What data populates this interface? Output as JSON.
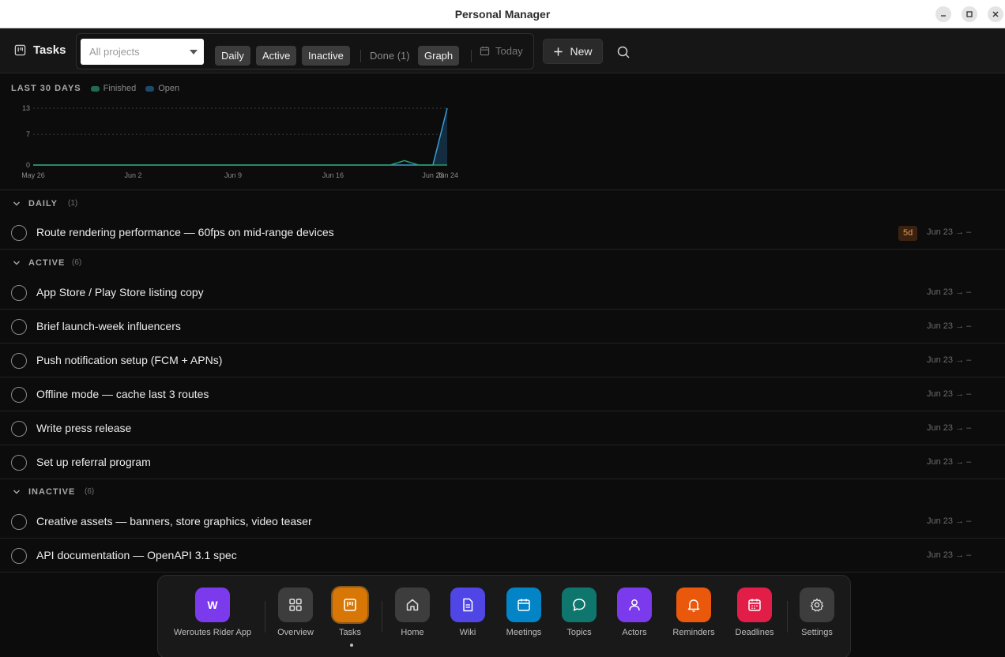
{
  "window": {
    "title": "Personal Manager"
  },
  "toolbar": {
    "title": "Tasks",
    "project_select": {
      "placeholder": "All projects"
    },
    "filters": [
      {
        "label": "Daily",
        "active": true
      },
      {
        "label": "Active",
        "active": true
      },
      {
        "label": "Inactive",
        "active": true
      },
      {
        "label": "Done (1)",
        "active": false
      },
      {
        "label": "Graph",
        "active": true
      }
    ],
    "today_label": "Today",
    "new_label": "New"
  },
  "graph": {
    "title": "LAST 30 DAYS",
    "legend": [
      {
        "name": "Finished",
        "color": "#1f6b4f"
      },
      {
        "name": "Open",
        "color": "#1c4a6b"
      }
    ]
  },
  "chart_data": {
    "type": "line",
    "x": [
      "May 26",
      "May 27",
      "May 28",
      "May 29",
      "May 30",
      "May 31",
      "Jun 1",
      "Jun 2",
      "Jun 3",
      "Jun 4",
      "Jun 5",
      "Jun 6",
      "Jun 7",
      "Jun 8",
      "Jun 9",
      "Jun 10",
      "Jun 11",
      "Jun 12",
      "Jun 13",
      "Jun 14",
      "Jun 15",
      "Jun 16",
      "Jun 17",
      "Jun 18",
      "Jun 19",
      "Jun 20",
      "Jun 21",
      "Jun 22",
      "Jun 23",
      "Jun 24"
    ],
    "series": [
      {
        "name": "Finished",
        "color": "#2a9a6c",
        "values": [
          0,
          0,
          0,
          0,
          0,
          0,
          0,
          0,
          0,
          0,
          0,
          0,
          0,
          0,
          0,
          0,
          0,
          0,
          0,
          0,
          0,
          0,
          0,
          0,
          0,
          0,
          1,
          0,
          0,
          0
        ]
      },
      {
        "name": "Open",
        "color": "#3a9ed4",
        "values": [
          0,
          0,
          0,
          0,
          0,
          0,
          0,
          0,
          0,
          0,
          0,
          0,
          0,
          0,
          0,
          0,
          0,
          0,
          0,
          0,
          0,
          0,
          0,
          0,
          0,
          0,
          0,
          0,
          0,
          13
        ]
      }
    ],
    "y_ticks": [
      "13",
      "7",
      "0"
    ],
    "x_ticks": [
      "May 26",
      "Jun 2",
      "Jun 9",
      "Jun 16",
      "Jun 23",
      "Jun 24"
    ],
    "ylim": [
      0,
      13
    ],
    "grid": true,
    "legend_position": "top-left"
  },
  "sections": [
    {
      "name": "DAILY",
      "count": "(1)",
      "tasks": [
        {
          "title": "Route rendering performance — 60fps on mid-range devices",
          "badge": "5d",
          "date": "Jun 23 → –"
        }
      ]
    },
    {
      "name": "ACTIVE",
      "count": "(6)",
      "tasks": [
        {
          "title": "App Store / Play Store listing copy",
          "date": "Jun 23 → –"
        },
        {
          "title": "Brief launch-week influencers",
          "date": "Jun 23 → –"
        },
        {
          "title": "Push notification setup (FCM + APNs)",
          "date": "Jun 23 → –"
        },
        {
          "title": "Offline mode — cache last 3 routes",
          "date": "Jun 23 → –"
        },
        {
          "title": "Write press release",
          "date": "Jun 23 → –"
        },
        {
          "title": "Set up referral program",
          "date": "Jun 23 → –"
        }
      ]
    },
    {
      "name": "INACTIVE",
      "count": "(6)",
      "tasks": [
        {
          "title": "Creative assets — banners, store graphics, video teaser",
          "date": "Jun 23 → –"
        },
        {
          "title": "API documentation — OpenAPI 3.1 spec",
          "date": "Jun 23 → –"
        }
      ]
    }
  ],
  "dock": {
    "apps": [
      {
        "label": "Weroutes Rider App",
        "glyph": "W",
        "color": "#7c3aed"
      },
      {
        "label": "Overview",
        "icon": "grid-icon",
        "color": "#3d3d3d"
      },
      {
        "label": "Tasks",
        "icon": "kanban-icon",
        "color": "#d97706",
        "active": true
      },
      {
        "label": "Home",
        "icon": "home-icon",
        "color": "#3d3d3d"
      },
      {
        "label": "Wiki",
        "icon": "document-icon",
        "color": "#4f46e5"
      },
      {
        "label": "Meetings",
        "icon": "calendar-icon",
        "color": "#0284c7"
      },
      {
        "label": "Topics",
        "icon": "chat-bubble-icon",
        "color": "#0f766e"
      },
      {
        "label": "Actors",
        "icon": "user-icon",
        "color": "#7c3aed"
      },
      {
        "label": "Reminders",
        "icon": "bell-icon",
        "color": "#ea580c"
      },
      {
        "label": "Deadlines",
        "icon": "calendar-grid-icon",
        "color": "#e11d48"
      },
      {
        "label": "Settings",
        "icon": "gear-icon",
        "color": "#3d3d3d"
      }
    ]
  }
}
